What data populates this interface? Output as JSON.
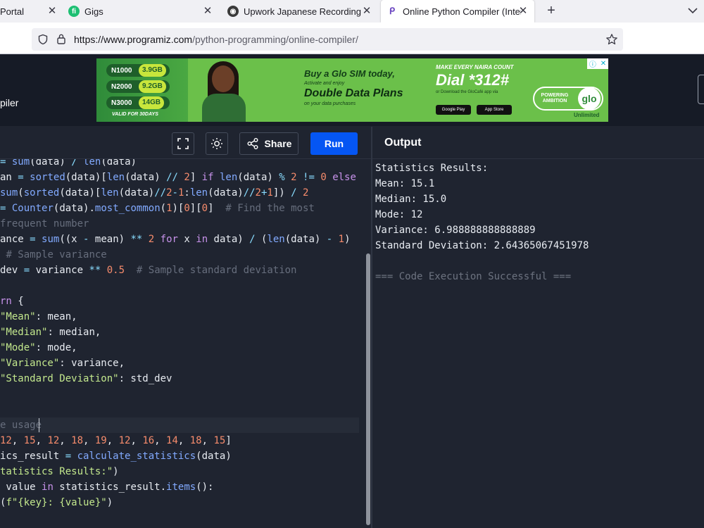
{
  "tabs": [
    {
      "label": "Portal",
      "icon": "portal-tab-icon",
      "active": false
    },
    {
      "label": "Gigs",
      "icon": "fiverr-tab-icon",
      "active": false
    },
    {
      "label": "Upwork Japanese Recording Pr",
      "icon": "upwork-tab-icon",
      "active": false
    },
    {
      "label": "Online Python Compiler (Interp",
      "icon": "programiz-tab-icon",
      "active": true
    }
  ],
  "address": {
    "host": "https://www.programiz.com",
    "path": "/python-programming/online-compiler/"
  },
  "site": {
    "brand_fragment": "piler"
  },
  "ad": {
    "offers": [
      {
        "price": "N1000",
        "data": "3.9GB"
      },
      {
        "price": "N2000",
        "data": "9.2GB"
      },
      {
        "price": "N3000",
        "data": "14GB"
      }
    ],
    "validity": "VALID FOR 30DAYS",
    "headline1": "Buy a Glo SIM today,",
    "headline2": "Activate and enjoy",
    "headline3": "Double Data Plans",
    "headline4": "on your data purchases",
    "count_tag": "MAKE EVERY NAIRA COUNT",
    "dial_code": "Dial *312#",
    "download_note": "or Download the GloCafé app via",
    "store1": "Google Play",
    "store2": "App Store",
    "slogan": "POWERING AMBITION",
    "brand": "glo",
    "unlimited": "Unlimited"
  },
  "toolbar": {
    "share_label": "Share",
    "run_label": "Run"
  },
  "output": {
    "title": "Output",
    "lines": [
      "Statistics Results:",
      "Mean: 15.1",
      "Median: 15.0",
      "Mode: 12",
      "Variance: 6.988888888888889",
      "Standard Deviation: 2.64365067451978",
      "",
      "=== Code Execution Successful ==="
    ]
  },
  "code": {
    "line1": "= sum(data) / len(data)",
    "line2": "an = sorted(data)[len(data) // 2] if len(data) % 2 != 0 else",
    "line3": "sum(sorted(data)[len(data)//2-1:len(data)//2+1]) / 2",
    "line4": "= Counter(data).most_common(1)[0][0]  # Find the most",
    "line5": "frequent number",
    "line6": "ance = sum((x - mean) ** 2 for x in data) / (len(data) - 1)",
    "line7": " # Sample variance",
    "line8": "dev = variance ** 0.5  # Sample standard deviation",
    "line10": "rn {",
    "line11": "\"Mean\": mean,",
    "line12": "\"Median\": median,",
    "line13": "\"Mode\": mode,",
    "line14": "\"Variance\": variance,",
    "line15": "\"Standard Deviation\": std_dev",
    "line18": "e usage",
    "line19": "12, 15, 12, 18, 19, 12, 16, 14, 18, 15]",
    "line20": "ics_result = calculate_statistics(data)",
    "line21": "tatistics Results:\")",
    "line22": " value in statistics_result.items():",
    "line23": "(f\"{key}: {value}\")"
  }
}
